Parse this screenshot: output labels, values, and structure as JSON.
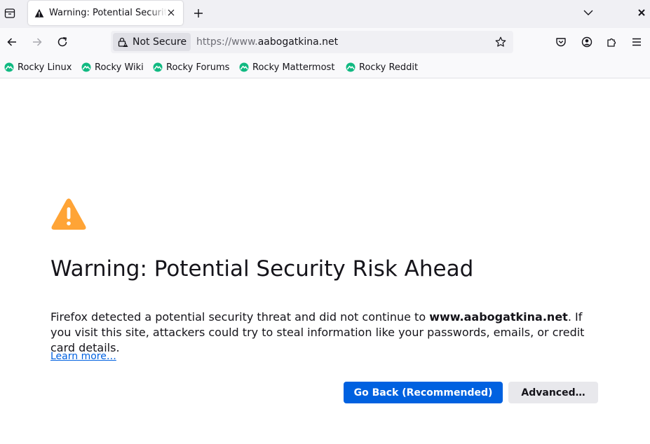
{
  "tab": {
    "title": "Warning: Potential Security Risk Ahead"
  },
  "toolbar": {
    "security_label": "Not Secure",
    "url_prefix": "https://www.",
    "url_domain": "aabogatkina.net"
  },
  "bookmarks": [
    {
      "label": "Rocky Linux"
    },
    {
      "label": "Rocky Wiki"
    },
    {
      "label": "Rocky Forums"
    },
    {
      "label": "Rocky Mattermost"
    },
    {
      "label": "Rocky Reddit"
    }
  ],
  "page": {
    "title": "Warning: Potential Security Risk Ahead",
    "desc_before": "Firefox detected a potential security threat and did not continue to ",
    "desc_domain": "www.aabogatkina.net",
    "desc_after": ". If you visit this site, attackers could try to steal information like your passwords, emails, or credit card details.",
    "learn_more": "Learn more…",
    "go_back": "Go Back (Recommended)",
    "advanced": "Advanced…"
  },
  "colors": {
    "accent": "#0061e0",
    "warning": "#ffa436",
    "bookmark_icon": "#10b981"
  }
}
